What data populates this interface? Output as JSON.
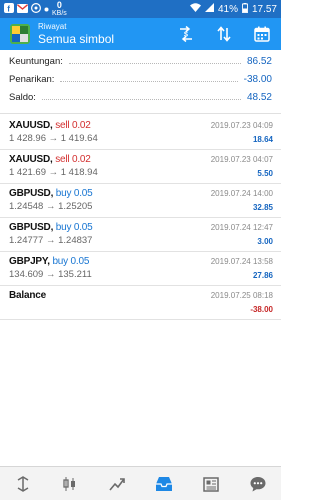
{
  "status_bar": {
    "speed_value": "0",
    "speed_unit": "KB/s",
    "battery": "41%",
    "time": "17.57"
  },
  "app_bar": {
    "subtitle": "Riwayat",
    "title": "Semua simbol",
    "icons": [
      "currency-exchange-icon",
      "sort-icon",
      "calendar-icon"
    ]
  },
  "summary": [
    {
      "label": "Keuntungan:",
      "value": "86.52"
    },
    {
      "label": "Penarikan:",
      "value": "-38.00"
    },
    {
      "label": "Saldo:",
      "value": "48.52"
    }
  ],
  "deals": [
    {
      "symbol": "XAUUSD,",
      "action": "sell 0.02",
      "side": "sell",
      "prices": "1 428.96 → 1 419.64",
      "date": "2019.07.23 04:09",
      "profit": "18.64"
    },
    {
      "symbol": "XAUUSD,",
      "action": "sell 0.02",
      "side": "sell",
      "prices": "1 421.69 → 1 418.94",
      "date": "2019.07.23 04:07",
      "profit": "5.50"
    },
    {
      "symbol": "GBPUSD,",
      "action": "buy 0.05",
      "side": "buy",
      "prices": "1.24548 → 1.25205",
      "date": "2019.07.24 14:00",
      "profit": "32.85"
    },
    {
      "symbol": "GBPUSD,",
      "action": "buy 0.05",
      "side": "buy",
      "prices": "1.24777 → 1.24837",
      "date": "2019.07.24 12:47",
      "profit": "3.00"
    },
    {
      "symbol": "GBPJPY,",
      "action": "buy 0.05",
      "side": "buy",
      "prices": "134.609 → 135.211",
      "date": "2019.07.24 13:58",
      "profit": "27.86"
    }
  ],
  "balance": {
    "label": "Balance",
    "date": "2019.07.25 08:18",
    "amount": "-38.00"
  },
  "nav": [
    "quotes-icon",
    "chart-icon",
    "trade-icon",
    "history-icon",
    "news-icon",
    "chat-icon"
  ],
  "colors": {
    "status_bar": "#1f6fc4",
    "app_bar": "#2196f3",
    "value_blue": "#1565c0",
    "sell_red": "#d32f2f",
    "buy_blue": "#1976d2",
    "active_nav": "#1e88e5"
  }
}
